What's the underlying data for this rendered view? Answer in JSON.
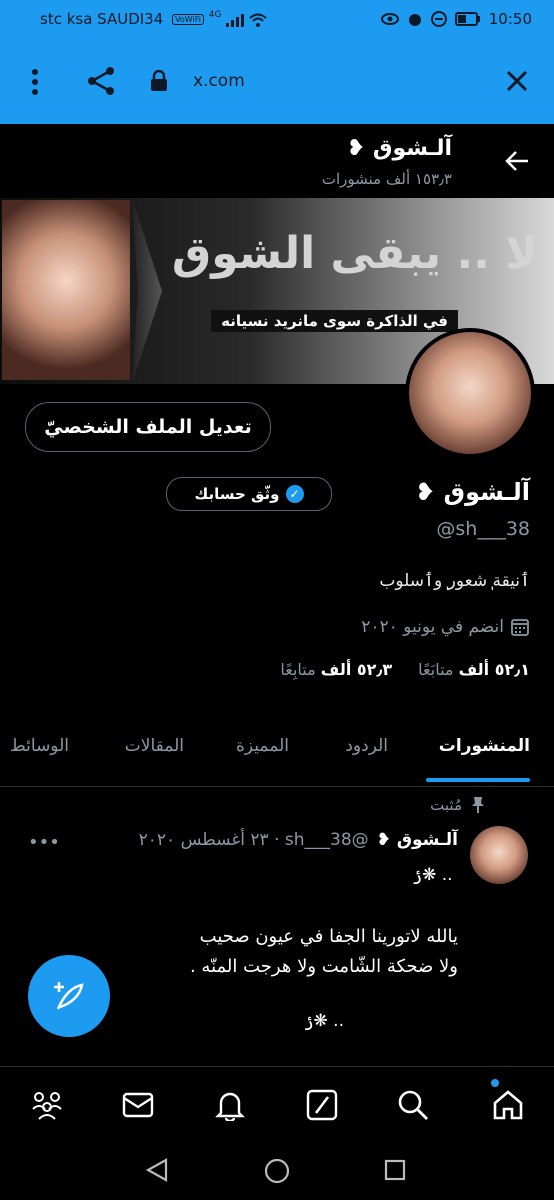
{
  "status_bar": {
    "carrier": "stc ksa SAUDI34",
    "volte": "VoWiFi",
    "signal": "4G",
    "time": "10:50"
  },
  "browser": {
    "url": "x.com"
  },
  "header": {
    "title": "آلـشوق ❥",
    "subtitle": "١٥٣٫٣ ألف منشورات"
  },
  "banner": {
    "headline": "لا .. يبقى الشوق",
    "tagline": "في الذاكرة سوى مانريد نسيانه"
  },
  "profile": {
    "edit_label": "تعديل الملف الشخصيّ",
    "verify_label": "وثّق حسابك",
    "display_name": "آلـشوق ❥",
    "handle": "@sh___38",
    "bio": "‎ٲنيقة ‌ٖشعور ‌ٖوٲسلوب",
    "joined": "انضم في يونيو ٢٠٢٠",
    "following_count": "٥٢٫١ ألف",
    "following_label": "متابَعًا",
    "followers_count": "٥٢٫٣ ألف",
    "followers_label": "متابِعًا"
  },
  "tabs": [
    {
      "label": "المنشورات"
    },
    {
      "label": "الردود"
    },
    {
      "label": "المميزة"
    },
    {
      "label": "المقالات"
    },
    {
      "label": "الوسائط"
    }
  ],
  "post": {
    "pinned_label": "مُثبت",
    "name": "آلـشوق ❥",
    "meta": "@sh___38 · ٢٣ أغسطس ٢٠٢٠",
    "more": "•••",
    "line1": "⁦⁩ .. ❋ݬ",
    "line2": "يالله لاتورينا الجفا في عيون صحيب",
    "line3": "ولا ضحكة الشّامت ولا هرجت المنّه .",
    "line4": ".. ❋ݬ"
  },
  "icons": {
    "back": "arrow-left-icon",
    "menu": "kebab-menu-icon",
    "share": "share-icon",
    "lock": "lock-icon",
    "close": "close-icon"
  },
  "colors": {
    "accent": "#1d9bf0",
    "background": "#000000",
    "muted": "#8b98a5"
  }
}
